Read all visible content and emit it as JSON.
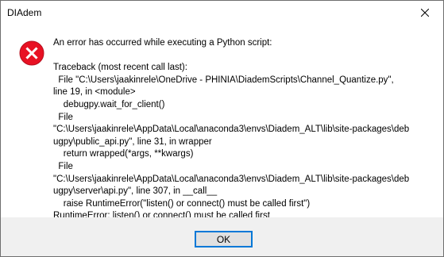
{
  "window": {
    "title": "DIAdem",
    "close_icon": "close-icon"
  },
  "dialog": {
    "icon": "error-icon",
    "icon_color": "#e81123",
    "headline": "An error has occurred while executing a Python script:",
    "traceback_lines": [
      "Traceback (most recent call last):",
      "  File \"C:\\Users\\jaakinrele\\OneDrive - PHINIA\\DiademScripts\\Channel_Quantize.py\",",
      "line 19, in <module>",
      "    debugpy.wait_for_client()",
      "  File",
      "\"C:\\Users\\jaakinrele\\AppData\\Local\\anaconda3\\envs\\Diadem_ALT\\lib\\site-packages\\deb",
      "ugpy\\public_api.py\", line 31, in wrapper",
      "    return wrapped(*args, **kwargs)",
      "  File",
      "\"C:\\Users\\jaakinrele\\AppData\\Local\\anaconda3\\envs\\Diadem_ALT\\lib\\site-packages\\deb",
      "ugpy\\server\\api.py\", line 307, in __call__",
      "    raise RuntimeError(\"listen() or connect() must be called first\")",
      "RuntimeError: listen() or connect() must be called first"
    ]
  },
  "footer": {
    "ok_label": "OK",
    "accent_color": "#0078d7"
  }
}
